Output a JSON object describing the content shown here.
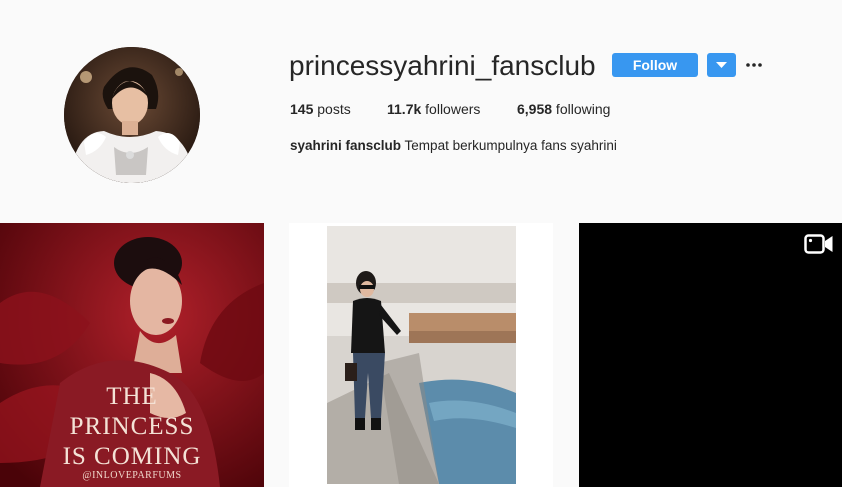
{
  "profile": {
    "username": "princessyahrini_fansclub",
    "follow_label": "Follow",
    "stats": {
      "posts_count": "145",
      "posts_label": " posts",
      "followers_count": "11.7k",
      "followers_label": " followers",
      "following_count": "6,958",
      "following_label": " following"
    },
    "bio_name": "syahrini fansclub",
    "bio_text": " Tempat berkumpulnya fans syahrini"
  },
  "posts": [
    {
      "type": "image",
      "overlay_lines": [
        "THE",
        "PRINCESS",
        "IS COMING",
        "@INLOVEPARFUMS"
      ]
    },
    {
      "type": "image"
    },
    {
      "type": "video",
      "icon": "video-icon"
    }
  ],
  "colors": {
    "accent": "#3897f0",
    "background": "#fafafa",
    "text": "#262626"
  }
}
